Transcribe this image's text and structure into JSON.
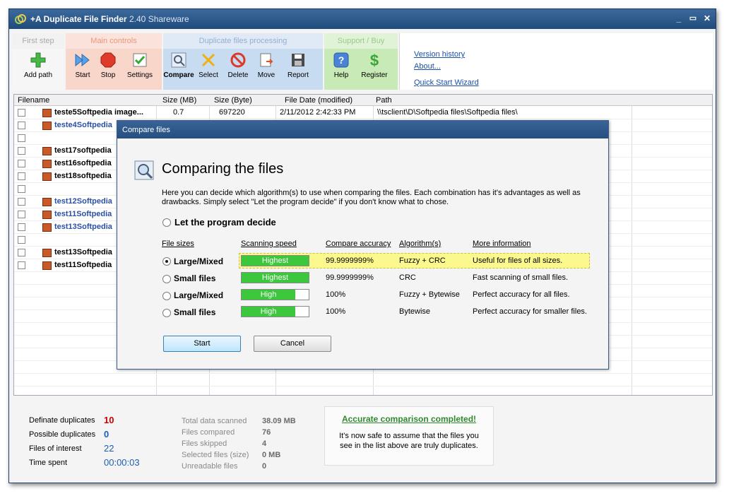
{
  "window": {
    "title": "+A Duplicate File Finder",
    "version": "2.40 Shareware"
  },
  "toolbar": {
    "groups": {
      "first_step": "First step",
      "main_controls": "Main controls",
      "duplicate_processing": "Duplicate files processing",
      "support_buy": "Support / Buy"
    },
    "buttons": {
      "add_path": "Add path",
      "start": "Start",
      "stop": "Stop",
      "settings": "Settings",
      "compare": "Compare",
      "select": "Select",
      "delete": "Delete",
      "move": "Move",
      "report": "Report",
      "help": "Help",
      "register": "Register"
    },
    "links": {
      "version_history": "Version history",
      "about": "About...",
      "quick_start": "Quick Start Wizard"
    }
  },
  "grid": {
    "columns": [
      "Filename",
      "Size (MB)",
      "Size (Byte)",
      "File Date (modified)",
      "Path"
    ],
    "rows": [
      {
        "name": "teste5Softpedia image...",
        "size_mb": "0.7",
        "size_byte": "697220",
        "date": "2/11/2012 2:42:33 PM",
        "path": "\\\\tsclient\\D\\Softpedia files\\Softpedia files\\"
      },
      {
        "name": "teste4Softpedia"
      },
      {
        "name": ""
      },
      {
        "name": "test17softpedia"
      },
      {
        "name": "test16softpedia"
      },
      {
        "name": "test18softpedia"
      },
      {
        "name": ""
      },
      {
        "name": "test12Softpedia"
      },
      {
        "name": "test11Softpedia"
      },
      {
        "name": "test13Softpedia"
      },
      {
        "name": ""
      },
      {
        "name": "test13Softpedia"
      },
      {
        "name": "test11Softpedia"
      }
    ]
  },
  "dialog": {
    "title": "Compare files",
    "heading": "Comparing the files",
    "description": "Here you can decide which algorithm(s) to use when comparing the files. Each combination has it's advantages as well as drawbacks. Simply select \"Let the program decide\" if you don't know what to chose.",
    "let_program_decide": "Let the program decide",
    "headers": {
      "file_sizes": "File sizes",
      "scanning_speed": "Scanning speed",
      "compare_accuracy": "Compare accuracy",
      "algorithms": "Algorithm(s)",
      "more_info": "More information"
    },
    "options": [
      {
        "size": "Large/Mixed",
        "speed": "Highest",
        "speed_level": 1.0,
        "accuracy": "99.9999999%",
        "algorithm": "Fuzzy + CRC",
        "info": "Useful for files of all sizes.",
        "selected": true
      },
      {
        "size": "Small files",
        "speed": "Highest",
        "speed_level": 1.0,
        "accuracy": "99.9999999%",
        "algorithm": "CRC",
        "info": "Fast scanning of small files.",
        "selected": false
      },
      {
        "size": "Large/Mixed",
        "speed": "High",
        "speed_level": 0.8,
        "accuracy": "100%",
        "algorithm": "Fuzzy + Bytewise",
        "info": "Perfect accuracy for all files.",
        "selected": false
      },
      {
        "size": "Small files",
        "speed": "High",
        "speed_level": 0.8,
        "accuracy": "100%",
        "algorithm": "Bytewise",
        "info": "Perfect accuracy for smaller files.",
        "selected": false
      }
    ],
    "start_label": "Start",
    "cancel_label": "Cancel"
  },
  "status": {
    "definite_label": "Definate duplicates",
    "definite_value": "10",
    "possible_label": "Possible duplicates",
    "possible_value": "0",
    "interest_label": "Files of interest",
    "interest_value": "22",
    "time_label": "Time spent",
    "time_value": "00:00:03",
    "total_scanned_label": "Total data scanned",
    "total_scanned_value": "38.09 MB",
    "files_compared_label": "Files compared",
    "files_compared_value": "76",
    "files_skipped_label": "Files skipped",
    "files_skipped_value": "4",
    "selected_label": "Selected files (size)",
    "selected_value": "0 MB",
    "unreadable_label": "Unreadable files",
    "unreadable_value": "0",
    "notice_title": "Accurate comparison completed!",
    "notice_body": "It's now safe to assume that the files you see in the list above are truly duplicates."
  },
  "colors": {
    "titlebar": "#1f4a7c",
    "definite": "#cc0000",
    "possible": "#1b5fb4",
    "notice_title": "#2e8a2e",
    "speed_fill": "#3cc73c",
    "highlight": "#fbf98e"
  }
}
